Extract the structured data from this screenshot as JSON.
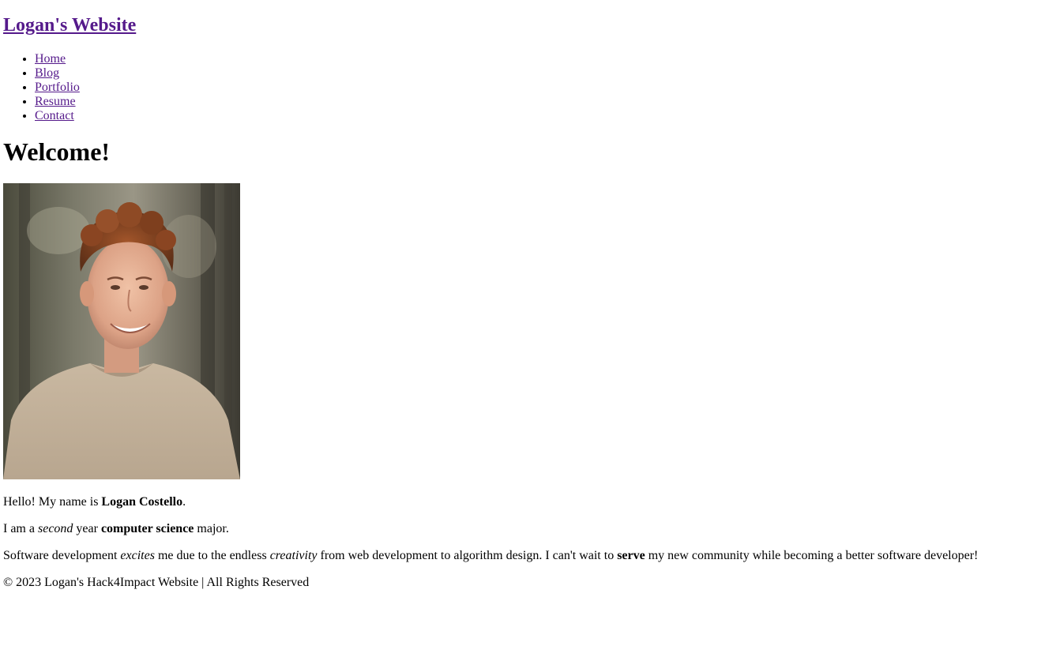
{
  "header": {
    "title": "Logan's Website"
  },
  "nav": {
    "items": [
      {
        "label": "Home"
      },
      {
        "label": "Blog"
      },
      {
        "label": "Portfolio"
      },
      {
        "label": "Resume"
      },
      {
        "label": "Contact"
      }
    ]
  },
  "main": {
    "heading": "Welcome!",
    "intro": {
      "prefix": "Hello! My name is ",
      "name": "Logan Costello",
      "suffix": "."
    },
    "year_line": {
      "part1": "I am a ",
      "year": "second",
      "part2": " year ",
      "major": "computer science",
      "part3": " major."
    },
    "passion_line": {
      "part1": "Software development ",
      "excites": "excites",
      "part2": " me due to the endless ",
      "creativity": "creativity",
      "part3": " from web development to algorithm design. I can't wait to ",
      "serve": "serve",
      "part4": " my new community while becoming a better software developer!"
    }
  },
  "footer": {
    "text": "© 2023 Logan's Hack4Impact Website | All Rights Reserved"
  },
  "colors": {
    "link": "#551a8b",
    "text": "#000000",
    "background": "#ffffff"
  }
}
